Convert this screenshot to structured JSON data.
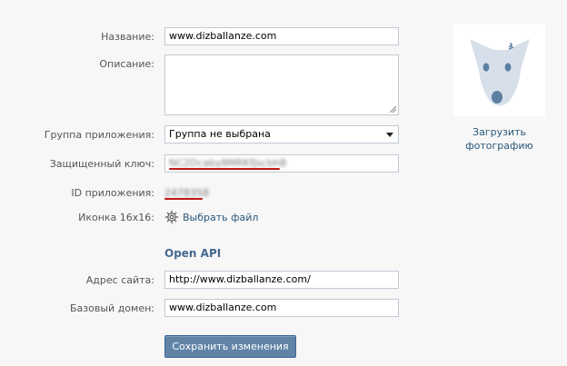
{
  "form": {
    "name_label": "Название:",
    "name_value": "www.dizballanze.com",
    "description_label": "Описание:",
    "description_value": "",
    "group_label": "Группа приложения:",
    "group_value": "Группа не выбрана",
    "secure_key_label": "Защищенный ключ:",
    "secure_key_value": "NC2Dcaby8MRKfJscbhB",
    "app_id_label": "ID приложения:",
    "app_id_value": "2478358",
    "icon_label": "Иконка 16x16:",
    "choose_file_label": "Выбрать файл"
  },
  "open_api": {
    "title": "Open API",
    "site_address_label": "Адрес сайта:",
    "site_address_value": "http://www.dizballanze.com/",
    "base_domain_label": "Базовый домен:",
    "base_domain_value": "www.dizballanze.com"
  },
  "save_button_label": "Сохранить изменения",
  "photo": {
    "upload_line1": "Загрузить",
    "upload_line2": "фотографию",
    "placeholder_icon": "dog-avatar-placeholder-icon"
  },
  "colors": {
    "accent": "#45688e",
    "link": "#2b587a",
    "button": "#6083a6",
    "redaction_underline": "#c01818"
  }
}
